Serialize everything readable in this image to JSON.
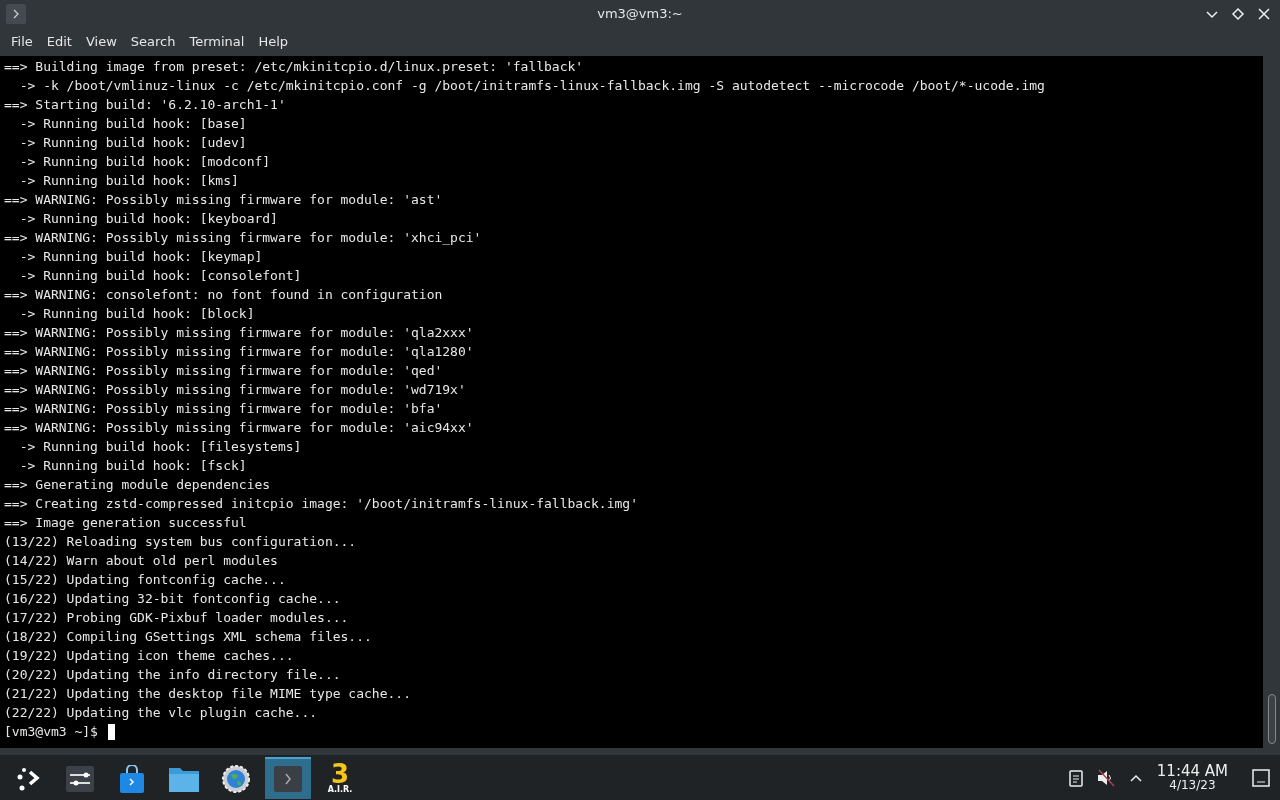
{
  "window": {
    "title": "vm3@vm3:~"
  },
  "menu": [
    "File",
    "Edit",
    "View",
    "Search",
    "Terminal",
    "Help"
  ],
  "terminal": {
    "lines": [
      "==> Building image from preset: /etc/mkinitcpio.d/linux.preset: 'fallback'",
      "  -> -k /boot/vmlinuz-linux -c /etc/mkinitcpio.conf -g /boot/initramfs-linux-fallback.img -S autodetect --microcode /boot/*-ucode.img",
      "==> Starting build: '6.2.10-arch1-1'",
      "  -> Running build hook: [base]",
      "  -> Running build hook: [udev]",
      "  -> Running build hook: [modconf]",
      "  -> Running build hook: [kms]",
      "==> WARNING: Possibly missing firmware for module: 'ast'",
      "  -> Running build hook: [keyboard]",
      "==> WARNING: Possibly missing firmware for module: 'xhci_pci'",
      "  -> Running build hook: [keymap]",
      "  -> Running build hook: [consolefont]",
      "==> WARNING: consolefont: no font found in configuration",
      "  -> Running build hook: [block]",
      "==> WARNING: Possibly missing firmware for module: 'qla2xxx'",
      "==> WARNING: Possibly missing firmware for module: 'qla1280'",
      "==> WARNING: Possibly missing firmware for module: 'qed'",
      "==> WARNING: Possibly missing firmware for module: 'wd719x'",
      "==> WARNING: Possibly missing firmware for module: 'bfa'",
      "==> WARNING: Possibly missing firmware for module: 'aic94xx'",
      "  -> Running build hook: [filesystems]",
      "  -> Running build hook: [fsck]",
      "==> Generating module dependencies",
      "==> Creating zstd-compressed initcpio image: '/boot/initramfs-linux-fallback.img'",
      "==> Image generation successful",
      "(13/22) Reloading system bus configuration...",
      "(14/22) Warn about old perl modules",
      "(15/22) Updating fontconfig cache...",
      "(16/22) Updating 32-bit fontconfig cache...",
      "(17/22) Probing GDK-Pixbuf loader modules...",
      "(18/22) Compiling GSettings XML schema files...",
      "(19/22) Updating icon theme caches...",
      "(20/22) Updating the info directory file...",
      "(21/22) Updating the desktop file MIME type cache...",
      "(22/22) Updating the vlc plugin cache..."
    ],
    "prompt": "[vm3@vm3 ~]$"
  },
  "taskbar": {
    "apps": [
      {
        "kind": "launcher",
        "selected": false
      },
      {
        "kind": "settings",
        "selected": false
      },
      {
        "kind": "store",
        "selected": false
      },
      {
        "kind": "files",
        "selected": false
      },
      {
        "kind": "globe",
        "selected": false
      },
      {
        "kind": "terminal",
        "selected": true
      },
      {
        "kind": "logo",
        "selected": false,
        "logo_number": "3",
        "logo_text": "A.I.R."
      }
    ],
    "clock": {
      "time": "11:44 AM",
      "date": "4/13/23"
    }
  }
}
